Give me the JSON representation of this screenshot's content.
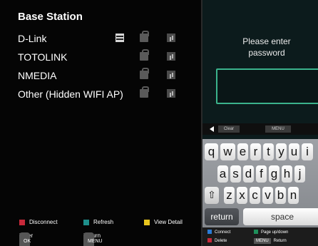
{
  "left": {
    "title": "Base Station",
    "networks": [
      {
        "name": "D-Link"
      },
      {
        "name": "TOTOLINK"
      },
      {
        "name": "NMEDIA"
      },
      {
        "name": "Other (Hidden WIFI AP)"
      }
    ],
    "legend": {
      "disconnect": "Disconnect",
      "refresh": "Refresh",
      "view_detail": "View Detail",
      "ok_key": "OK",
      "enter": "Enter",
      "menu_key": "MENU",
      "return": "Return"
    },
    "colors": {
      "red": "#c8293a",
      "teal": "#1e8f8b",
      "yellow": "#e8c51e"
    }
  },
  "right": {
    "prompt_line1": "Please enter",
    "prompt_line2": "password",
    "password_value": "",
    "options": {
      "clear": "Clear",
      "menu": "MENU"
    },
    "keyboard": {
      "row1": [
        "q",
        "w",
        "e",
        "r",
        "t",
        "y",
        "u",
        "i"
      ],
      "row2": [
        "a",
        "s",
        "d",
        "f",
        "g",
        "h",
        "j"
      ],
      "row3": [
        "z",
        "x",
        "c",
        "v",
        "b",
        "n"
      ],
      "shift_symbol": "⇧",
      "return_label": "return",
      "space_label": "space"
    },
    "kb_legend": {
      "connect": "Connect",
      "page_updown": "Page up/down",
      "delete": "Delete",
      "menu_key": "MENU",
      "return": "Return"
    },
    "colors": {
      "accent": "#3bb38c",
      "blue": "#2a7bd6",
      "green": "#1e8f5a",
      "red": "#c8293a"
    }
  }
}
